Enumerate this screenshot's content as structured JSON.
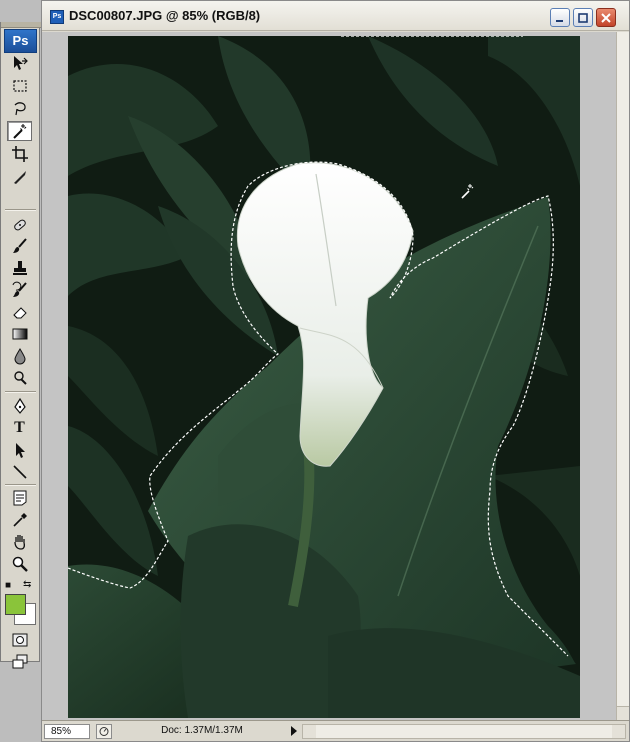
{
  "app": {
    "logo_text": "Ps"
  },
  "toolbox": {
    "tools": [
      {
        "name": "move-tool-icon",
        "active": false
      },
      {
        "name": "marquee-tool-icon",
        "active": false
      },
      {
        "name": "lasso-tool-icon",
        "active": false
      },
      {
        "name": "magic-wand-tool-icon",
        "active": true
      },
      {
        "name": "crop-tool-icon",
        "active": false
      },
      {
        "name": "slice-tool-icon",
        "active": false
      },
      {
        "name": "healing-brush-tool-icon",
        "active": false
      },
      {
        "name": "brush-tool-icon",
        "active": false
      },
      {
        "name": "clone-stamp-tool-icon",
        "active": false
      },
      {
        "name": "history-brush-tool-icon",
        "active": false
      },
      {
        "name": "eraser-tool-icon",
        "active": false
      },
      {
        "name": "gradient-tool-icon",
        "active": false
      },
      {
        "name": "blur-tool-icon",
        "active": false
      },
      {
        "name": "dodge-tool-icon",
        "active": false
      },
      {
        "name": "pen-tool-icon",
        "active": false
      },
      {
        "name": "type-tool-icon",
        "active": false
      },
      {
        "name": "path-selection-tool-icon",
        "active": false
      },
      {
        "name": "line-tool-icon",
        "active": false
      },
      {
        "name": "notes-tool-icon",
        "active": false
      },
      {
        "name": "eyedropper-tool-icon",
        "active": false
      },
      {
        "name": "hand-tool-icon",
        "active": false
      },
      {
        "name": "zoom-tool-icon",
        "active": false
      }
    ],
    "type_tool_glyph": "T",
    "foreground_color": "#8ac43a",
    "background_color": "#ffffff"
  },
  "document": {
    "title": "DSC00807.JPG @ 85% (RGB/8)",
    "zoom_value": "85%",
    "doc_info": "Doc: 1.37M/1.37M"
  },
  "colors": {
    "selection_marquee": "#ffffff",
    "leaf_dark": "#1d3322",
    "flower": "#f2f5f1"
  }
}
